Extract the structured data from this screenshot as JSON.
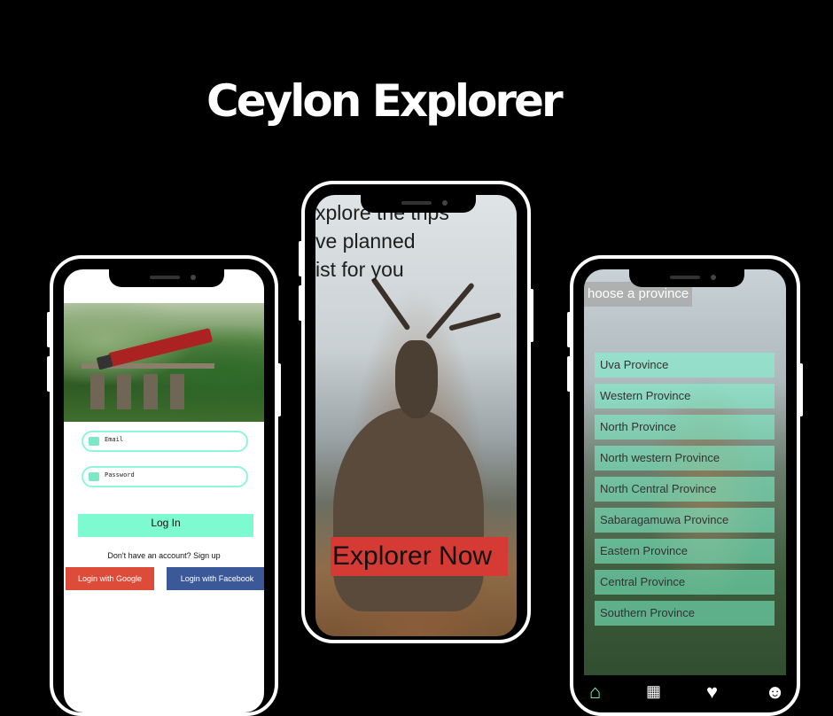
{
  "title": "Ceylon Explorer",
  "login_screen": {
    "email_label": "Email",
    "password_label": "Password",
    "login_button": "Log In",
    "signup_text": "Don't have an account? Sign up",
    "google_button": "Login with Google",
    "facebook_button": "Login with Facebook"
  },
  "welcome_screen": {
    "headline_lines": [
      "xplore the trips",
      "ve planned",
      "ist for you"
    ],
    "cta_button": "Explorer Now"
  },
  "province_screen": {
    "heading": "hoose a province",
    "provinces": [
      "Uva Province",
      "Western Province",
      "North Province",
      "North western Province",
      "North Central Province",
      "Sabaragamuwa Province",
      "Eastern Province",
      "Central Province",
      "Southern Province"
    ],
    "nav_icons": [
      "home-icon",
      "calendar-icon",
      "heart-icon",
      "profile-icon"
    ]
  },
  "colors": {
    "accent": "#7dfad0",
    "google": "#dd4b39",
    "facebook": "#3b5998",
    "cta": "#d63a35",
    "background": "#000000"
  }
}
